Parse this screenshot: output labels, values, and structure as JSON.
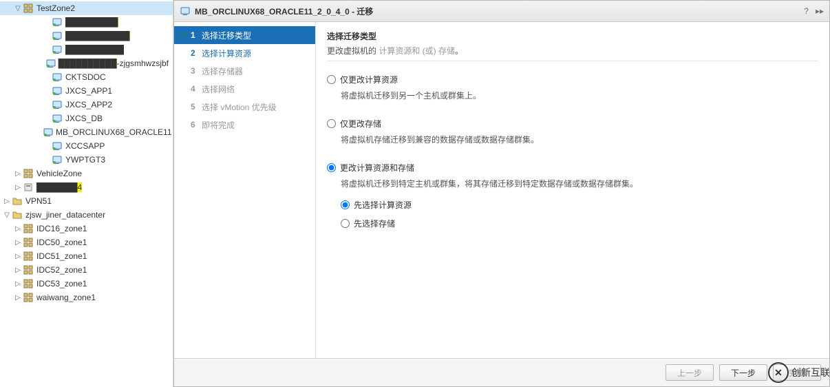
{
  "tree": {
    "items": [
      {
        "depth": 1,
        "icon": "cluster",
        "twisty": "▽",
        "label": "TestZone2",
        "sel": true
      },
      {
        "depth": 3,
        "icon": "vm",
        "label": "█████████",
        "hl": true
      },
      {
        "depth": 3,
        "icon": "vm",
        "label": "███████████",
        "hl": true
      },
      {
        "depth": 3,
        "icon": "vm",
        "label": "██████████",
        "hl": true
      },
      {
        "depth": 3,
        "icon": "vm",
        "label_prefix_hl": "██████████",
        "label": "-zjgsmhwzsjbf"
      },
      {
        "depth": 3,
        "icon": "vm",
        "label": "CKTSDOC"
      },
      {
        "depth": 3,
        "icon": "vm",
        "label": "JXCS_APP1"
      },
      {
        "depth": 3,
        "icon": "vm",
        "label": "JXCS_APP2"
      },
      {
        "depth": 3,
        "icon": "vm",
        "label": "JXCS_DB"
      },
      {
        "depth": 3,
        "icon": "vm",
        "label": "MB_ORCLINUX68_ORACLE11"
      },
      {
        "depth": 3,
        "icon": "vm",
        "label": "XCCSAPP"
      },
      {
        "depth": 3,
        "icon": "vm",
        "label": "YWPTGT3"
      },
      {
        "depth": 1,
        "icon": "cluster",
        "twisty": "▷",
        "label": "VehicleZone"
      },
      {
        "depth": 1,
        "icon": "host",
        "twisty": "▷",
        "label": "███████4",
        "hl": true
      },
      {
        "depth": 0,
        "icon": "folder",
        "twisty": "▷",
        "label": "VPN51"
      },
      {
        "depth": 0,
        "icon": "folder",
        "twisty": "▽",
        "label": "zjsw_jiner_datacenter"
      },
      {
        "depth": 1,
        "icon": "cluster",
        "twisty": "▷",
        "label": "IDC16_zone1"
      },
      {
        "depth": 1,
        "icon": "cluster",
        "twisty": "▷",
        "label": "IDC50_zone1"
      },
      {
        "depth": 1,
        "icon": "cluster",
        "twisty": "▷",
        "label": "IDC51_zone1"
      },
      {
        "depth": 1,
        "icon": "cluster",
        "twisty": "▷",
        "label": "IDC52_zone1"
      },
      {
        "depth": 1,
        "icon": "cluster",
        "twisty": "▷",
        "label": "IDC53_zone1"
      },
      {
        "depth": 1,
        "icon": "cluster",
        "twisty": "▷",
        "label": "waiwang_zone1"
      }
    ]
  },
  "dialog": {
    "title": "MB_ORCLINUX68_ORACLE11_2_0_4_0 - 迁移",
    "steps": [
      {
        "num": "1",
        "label": "选择迁移类型",
        "state": "active-done"
      },
      {
        "num": "2",
        "label": "选择计算资源",
        "state": "link"
      },
      {
        "num": "3",
        "label": "选择存储器",
        "state": ""
      },
      {
        "num": "4",
        "label": "选择网络",
        "state": ""
      },
      {
        "num": "5",
        "label": "选择 vMotion 优先级",
        "state": ""
      },
      {
        "num": "6",
        "label": "即将完成",
        "state": ""
      }
    ],
    "heading": "选择迁移类型",
    "sub_pre": "更改虚拟机的 ",
    "sub_grey": "计算资源和 (或) 存储",
    "sub_post": "。",
    "options": [
      {
        "id": "opt-compute",
        "label": "仅更改计算资源",
        "desc": "将虚拟机迁移到另一个主机或群集上。",
        "checked": false
      },
      {
        "id": "opt-storage",
        "label": "仅更改存储",
        "desc": "将虚拟机存储迁移到兼容的数据存储或数据存储群集。",
        "checked": false
      },
      {
        "id": "opt-both",
        "label": "更改计算资源和存储",
        "desc": "将虚拟机迁移到特定主机或群集，将其存储迁移到特定数据存储或数据存储群集。",
        "checked": true,
        "sub": [
          {
            "id": "sub-compute-first",
            "label": "先选择计算资源",
            "checked": true
          },
          {
            "id": "sub-storage-first",
            "label": "先选择存储",
            "checked": false
          }
        ]
      }
    ],
    "buttons": {
      "back": "上一步",
      "next": "下一步",
      "finish": "完成"
    }
  },
  "watermark": {
    "text": "创新互联"
  }
}
